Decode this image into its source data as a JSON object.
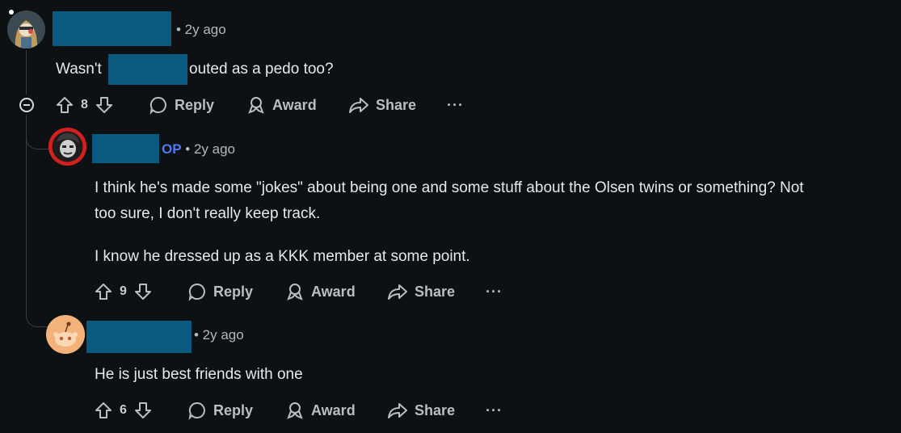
{
  "comments": [
    {
      "time": "• 2y ago",
      "text_before": "Wasn't",
      "text_after": "outed as a pedo too?",
      "votes": "8",
      "reply": "Reply",
      "award": "Award",
      "share": "Share",
      "more": "···"
    },
    {
      "op_tag": "OP",
      "time": "• 2y ago",
      "line1": "I think he's made some \"jokes\" about being one and some stuff about the Olsen twins or something? Not",
      "line2": "too sure, I don't really keep track.",
      "line3": "I know he dressed up as a KKK member at some point.",
      "votes": "9",
      "reply": "Reply",
      "award": "Award",
      "share": "Share",
      "more": "···"
    },
    {
      "time": "• 2y ago",
      "text": "He is just best friends with one",
      "votes": "6",
      "reply": "Reply",
      "award": "Award",
      "share": "Share",
      "more": "···"
    }
  ],
  "colors": {
    "background": "#0e1113",
    "redaction": "#0a5a80",
    "op_tag": "#4f7cf0",
    "thread_line": "#333d42"
  }
}
